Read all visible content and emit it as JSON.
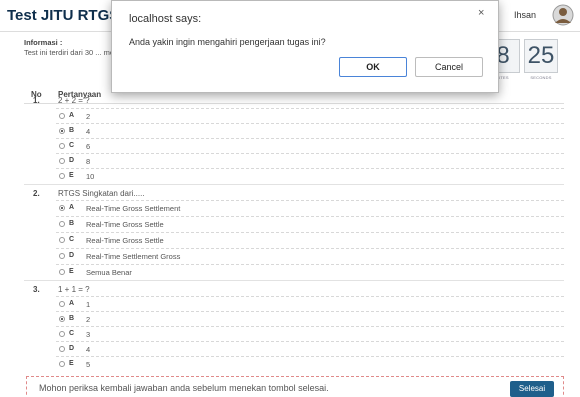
{
  "header": {
    "title": "Test JITU RTGS",
    "user_name": "Ihsan"
  },
  "info": {
    "title": "Informasi :",
    "text": "Test ini terdiri dari 30 ... menjawab harap me... berdoa, periksa kem..."
  },
  "timer": {
    "minutes": "8",
    "seconds": "25",
    "minutes_label": "UTES",
    "seconds_label": "SECONDS"
  },
  "table": {
    "col_no": "No",
    "col_question": "Pertanyaan"
  },
  "questions": [
    {
      "number": "1.",
      "text": "2 + 2 = ?",
      "options": [
        {
          "letter": "A",
          "text": "2",
          "checked": false
        },
        {
          "letter": "B",
          "text": "4",
          "checked": true
        },
        {
          "letter": "C",
          "text": "6",
          "checked": false
        },
        {
          "letter": "D",
          "text": "8",
          "checked": false
        },
        {
          "letter": "E",
          "text": "10",
          "checked": false
        }
      ]
    },
    {
      "number": "2.",
      "text": "RTGS Singkatan dari.....",
      "options": [
        {
          "letter": "A",
          "text": "Real-Time Gross Settlement",
          "checked": true
        },
        {
          "letter": "B",
          "text": "Real-Time Gross Settle",
          "checked": false
        },
        {
          "letter": "C",
          "text": "Real-Time Gross Settle",
          "checked": false
        },
        {
          "letter": "D",
          "text": "Real-Time  Settlement Gross",
          "checked": false
        },
        {
          "letter": "E",
          "text": "Semua Benar",
          "checked": false
        }
      ]
    },
    {
      "number": "3.",
      "text": "1 + 1 = ?",
      "options": [
        {
          "letter": "A",
          "text": "1",
          "checked": false
        },
        {
          "letter": "B",
          "text": "2",
          "checked": true
        },
        {
          "letter": "C",
          "text": "3",
          "checked": false
        },
        {
          "letter": "D",
          "text": "4",
          "checked": false
        },
        {
          "letter": "E",
          "text": "5",
          "checked": false
        }
      ]
    }
  ],
  "footer": {
    "text": "Mohon periksa kembali jawaban anda sebelum menekan tombol selesai.",
    "done_label": "Selesai"
  },
  "dialog": {
    "title": "localhost says:",
    "close": "×",
    "message": "Anda yakin ingin mengahiri pengerjaan tugas ini?",
    "ok_label": "OK",
    "cancel_label": "Cancel"
  },
  "colors": {
    "brand": "#0f2f4c",
    "done_button": "#1f5f8b",
    "ok_border": "#4a84d8"
  }
}
